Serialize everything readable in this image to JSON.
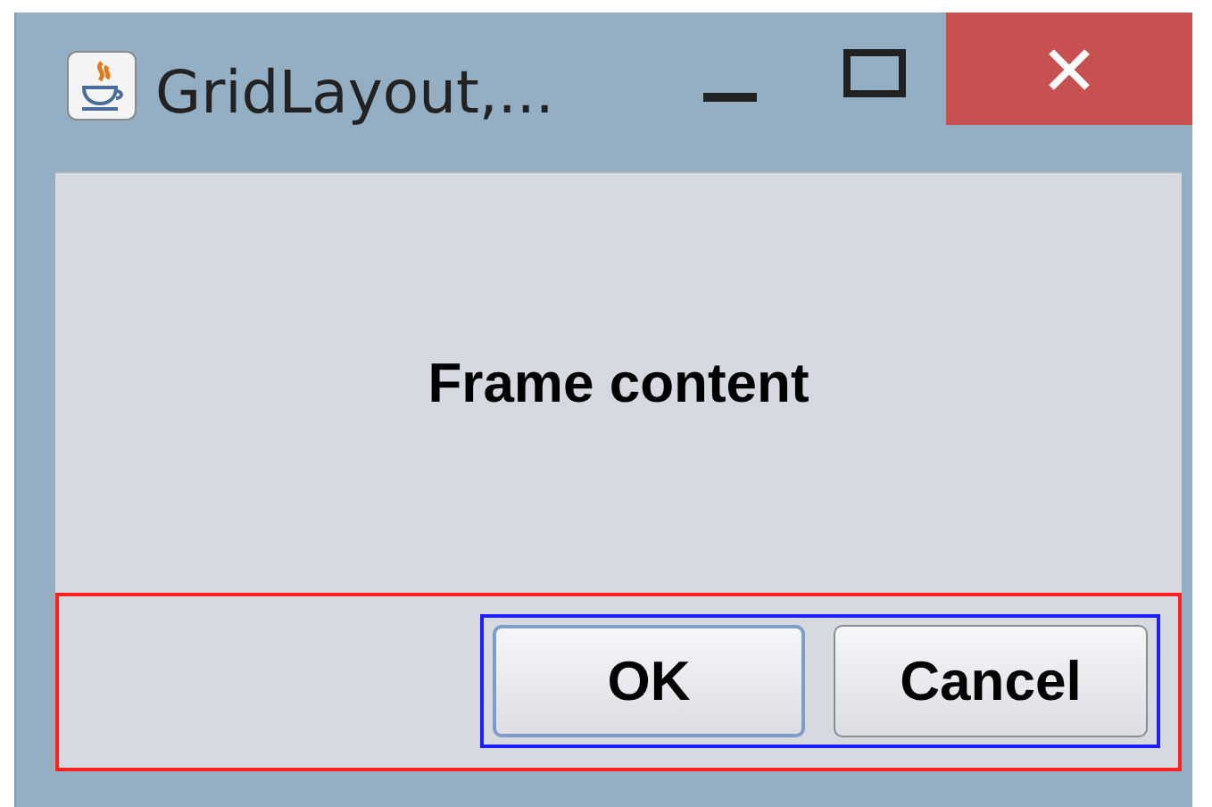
{
  "window": {
    "title": "GridLayout,..."
  },
  "content": {
    "label": "Frame content"
  },
  "buttons": [
    {
      "label": "OK",
      "focused": true
    },
    {
      "label": "Cancel",
      "focused": false
    }
  ]
}
